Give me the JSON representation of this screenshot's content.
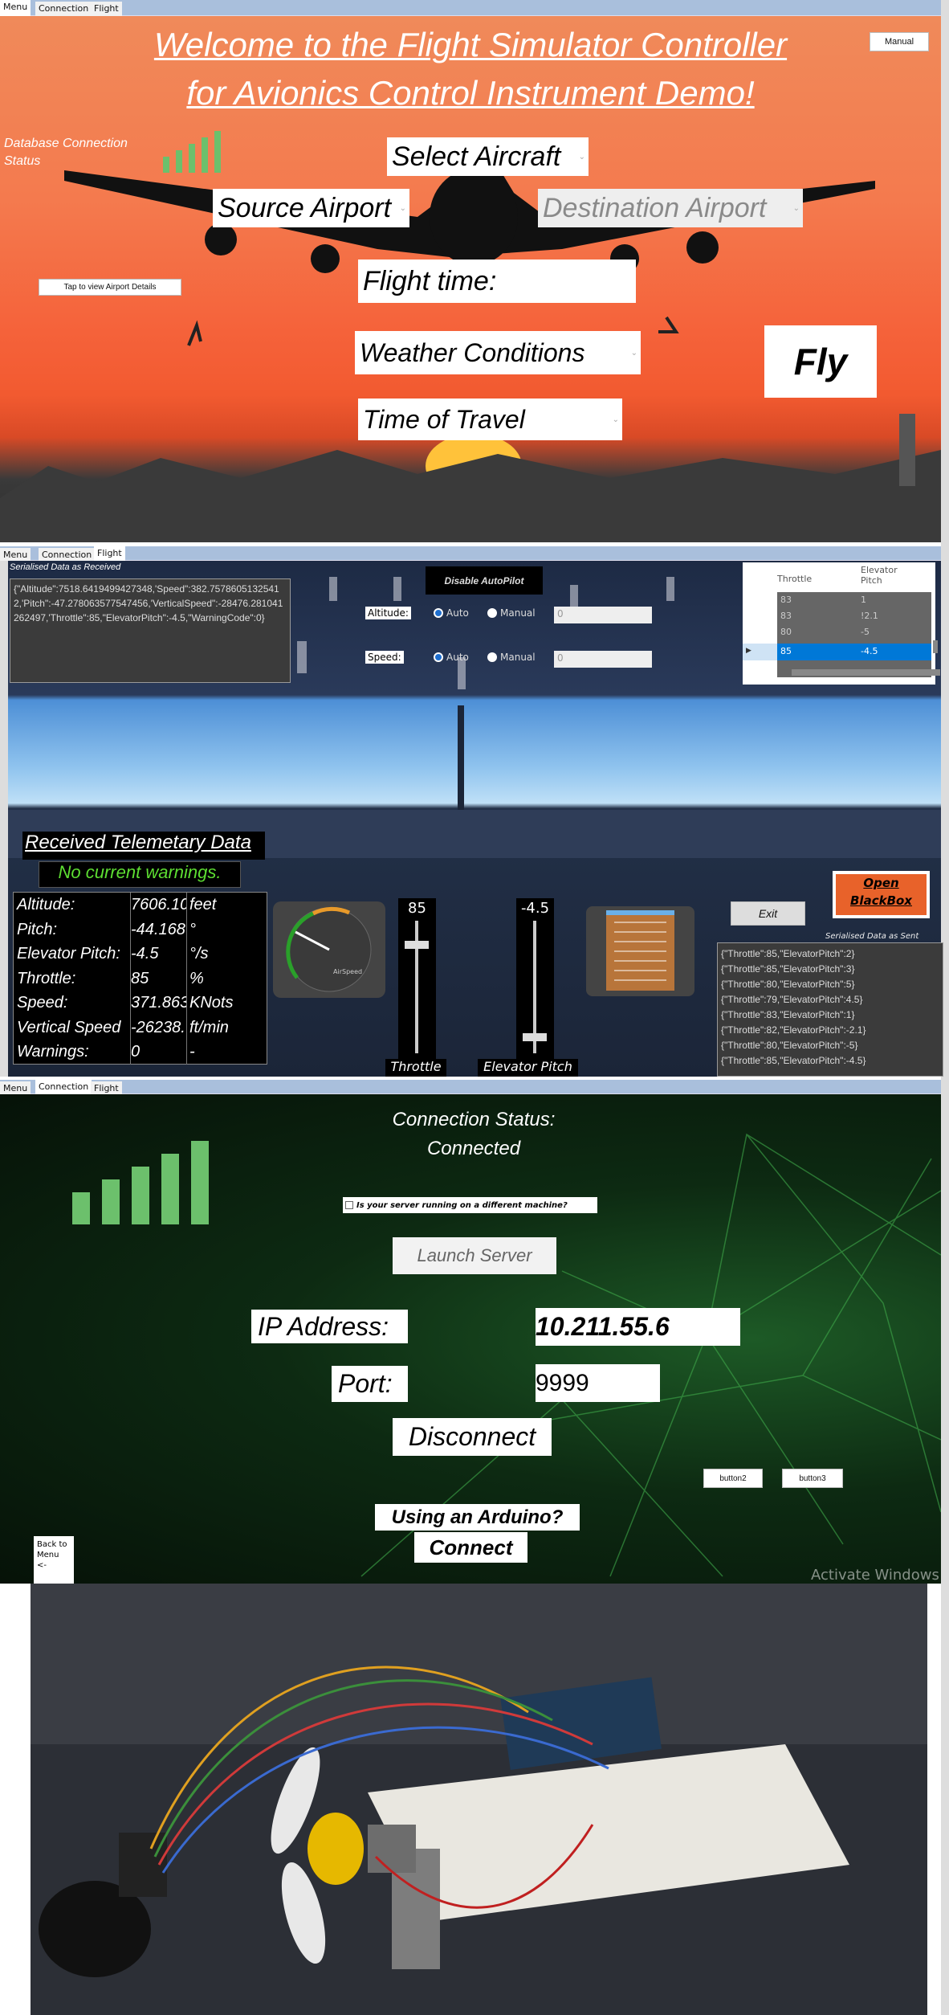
{
  "tabs": [
    "Menu",
    "Connection",
    "Flight"
  ],
  "menu_page": {
    "title_line1": "Welcome to the Flight Simulator Controller",
    "title_line2": "for Avionics Control Instrument Demo!",
    "manual_button": "Manual",
    "db_status_label": "Database Connection Status",
    "db_signal_level": "5/5",
    "select_aircraft": "Select Aircraft",
    "source_airport": "Source Airport",
    "destination_airport": "Destination Airport",
    "airport_details_button": "Tap to view Airport Details",
    "flight_time": "Flight time:",
    "weather_conditions": "Weather Conditions",
    "time_of_travel": "Time of Travel",
    "fly_button": "Fly"
  },
  "flight_page": {
    "received_label": "Serialised Data as Received",
    "received_text": "{\"Altitude\":7518.6419499427348,'Speed\":382.75786051325412,'Pitch\":-47.278063577547456,'VerticalSpeed\":-28476.281041262497,'Throttle\":85,\"ElevatorPitch\":-4.5,\"WarningCode\":0}",
    "disable_autopilot": "Disable AutoPilot",
    "altitude_label": "Altitude:",
    "speed_label": "Speed:",
    "auto": "Auto",
    "manual": "Manual",
    "altitude_spinner": "0",
    "speed_spinner": "0",
    "grid": {
      "headers": [
        "Throttle",
        "Elevator Pitch"
      ],
      "rows": [
        [
          "83",
          "1"
        ],
        [
          "83",
          "!2.1"
        ],
        [
          "80",
          "-5"
        ],
        [
          "85",
          "-4.5"
        ]
      ],
      "selected_row": 3
    },
    "telemetry_title": "Received Telemetary Data",
    "warning_status": "No current warnings.",
    "telemetry": [
      {
        "label": "Altitude:",
        "value": "7606.10",
        "unit": "feet"
      },
      {
        "label": "Pitch:",
        "value": "-44.168",
        "unit": "°"
      },
      {
        "label": "Elevator Pitch:",
        "value": "-4.5",
        "unit": "°/s"
      },
      {
        "label": "Throttle:",
        "value": "85",
        "unit": "%"
      },
      {
        "label": "Speed:",
        "value": "371.863",
        "unit": "KNots"
      },
      {
        "label": "Vertical Speed",
        "value": "-26238.",
        "unit": "ft/min"
      },
      {
        "label": "Warnings:",
        "value": "0",
        "unit": "-"
      }
    ],
    "throttle_value": "85",
    "throttle_level_pct": 85,
    "throttle_label": "Throttle",
    "elevator_value": "-4.5",
    "elevator_label": "Elevator Pitch",
    "airspeed_gauge_label": "AirSpeed",
    "exit_button": "Exit",
    "blackbox_button": "Open BlackBox",
    "sent_label": "Serialised Data as Sent",
    "sent": [
      "{\"Throttle\":85,\"ElevatorPitch\":2}",
      "{\"Throttle\":85,\"ElevatorPitch\":3}",
      "{\"Throttle\":80,\"ElevatorPitch\":5}",
      "{\"Throttle\":79,\"ElevatorPitch\":4.5}",
      "{\"Throttle\":83,\"ElevatorPitch\":1}",
      "{\"Throttle\":82,\"ElevatorPitch\":-2.1}",
      "{\"Throttle\":80,\"ElevatorPitch\":-5}",
      "{\"Throttle\":85,\"ElevatorPitch\":-4.5}"
    ]
  },
  "connection_page": {
    "status_label": "Connection Status:",
    "status_value": "Connected",
    "signal_level": "5/5",
    "different_machine": "Is your server running on a different machine?",
    "launch_server": "Launch Server",
    "ip_label": "IP Address:",
    "ip_value": "10.211.55.6",
    "port_label": "Port:",
    "port_value": "9999",
    "disconnect": "Disconnect",
    "button2": "button2",
    "button3": "button3",
    "arduino_label": "Using an Arduino?",
    "connect": "Connect",
    "back_button": "Back to Menu <-",
    "watermark": "Activate Windows"
  },
  "colors": {
    "tab_bar": "#a9bfdc",
    "signal_green": "#6cc06c",
    "warning_green": "#5dde32",
    "selected_row": "#0078d7"
  }
}
